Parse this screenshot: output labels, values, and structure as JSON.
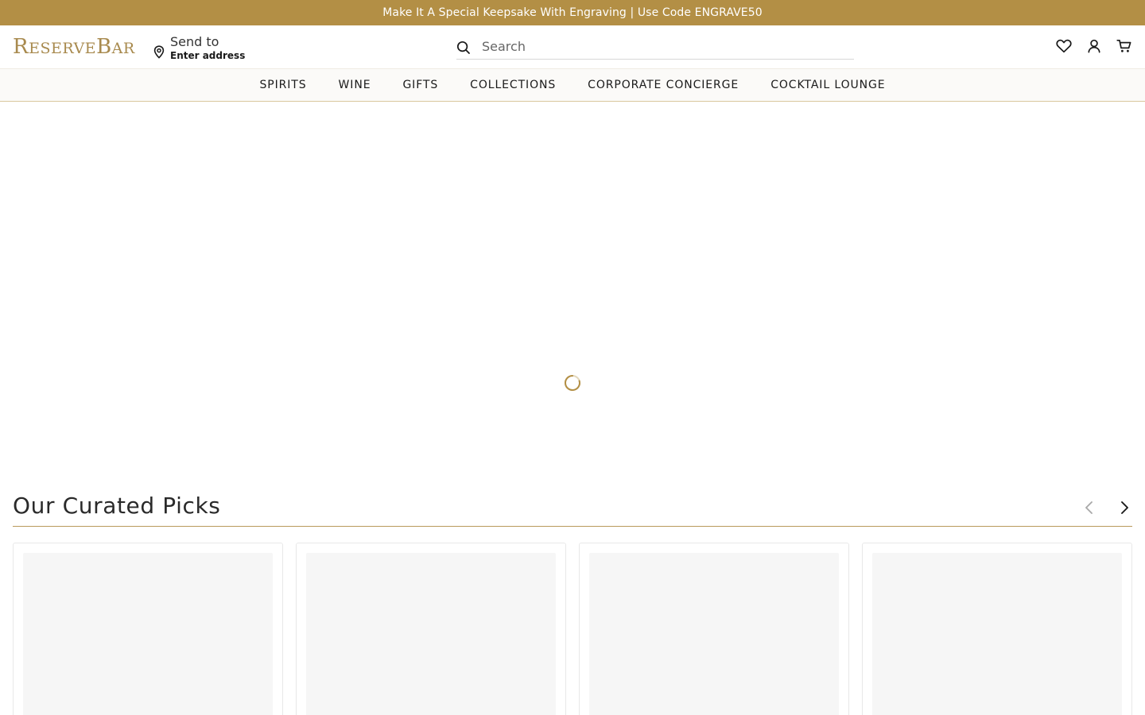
{
  "promo": {
    "text": "Make It A Special Keepsake With Engraving | Use Code ENGRAVE50"
  },
  "header": {
    "logo": {
      "r": "R",
      "eserve": "ESERVE",
      "b": "B",
      "ar": "AR"
    },
    "send_to": {
      "label": "Send to",
      "address": "Enter address"
    },
    "search": {
      "placeholder": "Search"
    },
    "icons": [
      "heart-icon",
      "user-icon",
      "cart-icon"
    ]
  },
  "nav": {
    "items": [
      {
        "label": "SPIRITS"
      },
      {
        "label": "WINE"
      },
      {
        "label": "GIFTS"
      },
      {
        "label": "COLLECTIONS"
      },
      {
        "label": "CORPORATE CONCIERGE"
      },
      {
        "label": "COCKTAIL LOUNGE"
      }
    ]
  },
  "curated": {
    "title": "Our Curated Picks",
    "cards": [
      {
        "state": "loading"
      },
      {
        "state": "loading"
      },
      {
        "state": "loading"
      },
      {
        "state": "loading"
      }
    ]
  },
  "colors": {
    "brand_gold": "#b38f45",
    "logo_gold": "#a88a4e",
    "divider_gold": "#b99a5b"
  }
}
